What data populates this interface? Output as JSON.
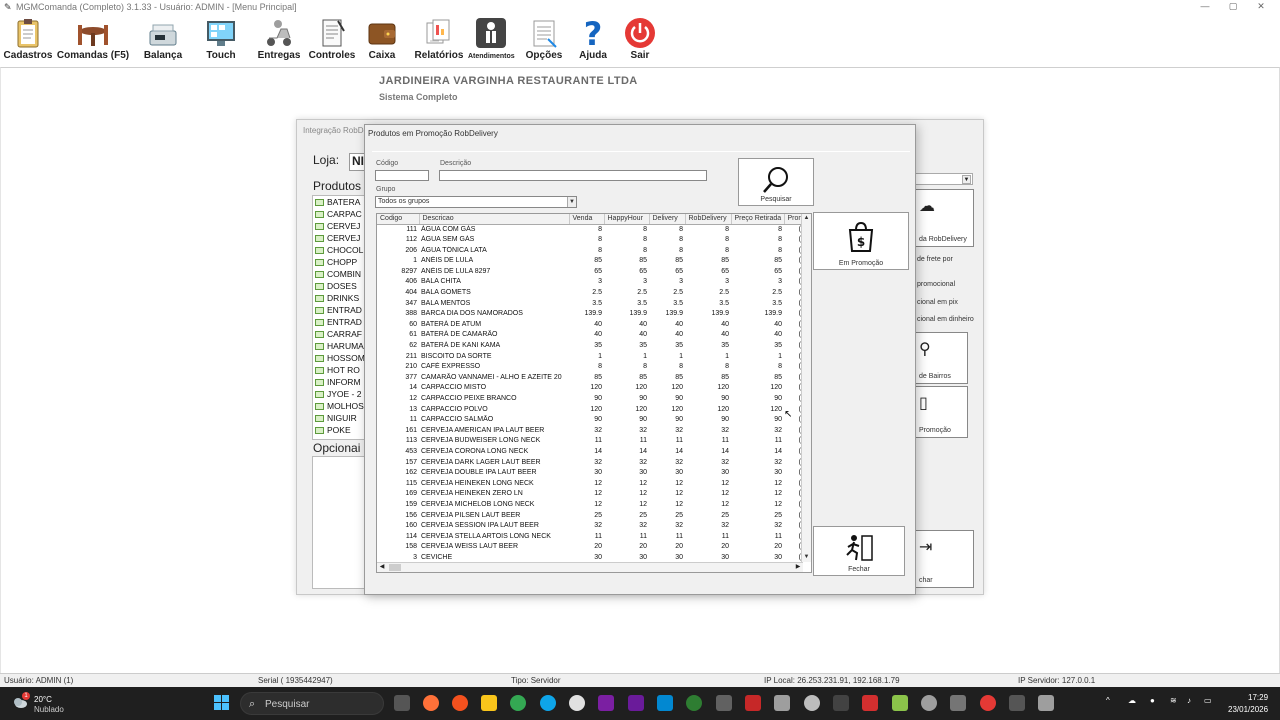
{
  "window": {
    "title": "MGMComanda (Completo) 3.1.33 - Usuário: ADMIN - [Menu Principal]"
  },
  "toolbar": [
    {
      "label": "Cadastros",
      "icon": "clipboard-icon"
    },
    {
      "label": "Comandas (F5)",
      "icon": "restaurant-table-icon"
    },
    {
      "label": "Balança",
      "icon": "scale-icon"
    },
    {
      "label": "Touch",
      "icon": "touch-screen-icon"
    },
    {
      "label": "Entregas",
      "icon": "delivery-scooter-icon"
    },
    {
      "label": "Controles",
      "icon": "notepad-icon"
    },
    {
      "label": "Caixa",
      "icon": "wallet-icon"
    },
    {
      "label": "Relatórios",
      "icon": "reports-icon"
    },
    {
      "label": "Atendimentos",
      "icon": "waiter-icon"
    },
    {
      "label": "Opções",
      "icon": "options-document-icon"
    },
    {
      "label": "Ajuda",
      "icon": "help-icon"
    },
    {
      "label": "Sair",
      "icon": "power-icon"
    }
  ],
  "company": {
    "name": "JARDINEIRA VARGINHA RESTAURANTE LTDA",
    "subtitle": "Sistema Completo"
  },
  "bg_window": {
    "title": "Integração RobDe",
    "loja_label": "Loja:",
    "loja_value": "NI",
    "produtos_label": "Produtos",
    "tree_items": [
      "BATERA",
      "CARPAC",
      "CERVEJ",
      "CERVEJ",
      "CHOCOL",
      "CHOPP",
      "COMBIN",
      "DOSES",
      "DRINKS",
      "ENTRAD",
      "ENTRAD",
      "CARRAF",
      "HARUMA",
      "HOSSOM",
      "HOT RO",
      "INFORM",
      "JYOE - 2",
      "MOLHOS",
      "NIGUIR",
      "POKE"
    ],
    "opcionais_label": "Opcionai",
    "right_texts": [
      "da RobDelivery",
      "de frete por",
      "promocional",
      "cional em pix",
      "cional em dinheiro",
      "de Bairros",
      "Promoção",
      "char"
    ]
  },
  "dialog": {
    "title": "Produtos em Promoção RobDelivery",
    "codigo_label": "Código",
    "descricao_label": "Descrição",
    "grupo_label": "Grupo",
    "grupo_value": "Todos os grupos",
    "codigo_value": "",
    "descricao_value": "",
    "pesquisar_label": "Pesquisar",
    "em_promocao_label": "Em Promoção",
    "fechar_label": "Fechar",
    "columns": [
      "Codigo",
      "Descricao",
      "Venda",
      "HappyHour",
      "Delivery",
      "RobDelivery",
      "Preço Retirada",
      "Pron"
    ],
    "rows": [
      [
        "111",
        "ÁGUA COM GÁS",
        "8",
        "8",
        "8",
        "8",
        "8",
        "("
      ],
      [
        "112",
        "ÁGUA SEM GÁS",
        "8",
        "8",
        "8",
        "8",
        "8",
        "("
      ],
      [
        "206",
        "ÁGUA TÔNICA LATA",
        "8",
        "8",
        "8",
        "8",
        "8",
        "("
      ],
      [
        "1",
        "ANÉIS DE LULA",
        "85",
        "85",
        "85",
        "85",
        "85",
        "("
      ],
      [
        "8297",
        "ANÉIS DE LULA 8297",
        "65",
        "65",
        "65",
        "65",
        "65",
        "("
      ],
      [
        "406",
        "BALA CHITA",
        "3",
        "3",
        "3",
        "3",
        "3",
        "("
      ],
      [
        "404",
        "BALA GOMETS",
        "2.5",
        "2.5",
        "2.5",
        "2.5",
        "2.5",
        "("
      ],
      [
        "347",
        "BALA MENTOS",
        "3.5",
        "3.5",
        "3.5",
        "3.5",
        "3.5",
        "("
      ],
      [
        "388",
        "BARCA DIA DOS NAMORADOS",
        "139.9",
        "139.9",
        "139.9",
        "139.9",
        "139.9",
        "("
      ],
      [
        "60",
        "BATERÁ DE ATUM",
        "40",
        "40",
        "40",
        "40",
        "40",
        "("
      ],
      [
        "61",
        "BATERÁ DE CAMARÃO",
        "40",
        "40",
        "40",
        "40",
        "40",
        "("
      ],
      [
        "62",
        "BATERÁ DE KANI KAMA",
        "35",
        "35",
        "35",
        "35",
        "35",
        "("
      ],
      [
        "211",
        "BISCOITO DA SORTE",
        "1",
        "1",
        "1",
        "1",
        "1",
        "("
      ],
      [
        "210",
        "CAFÉ EXPRESSO",
        "8",
        "8",
        "8",
        "8",
        "8",
        "("
      ],
      [
        "377",
        "CAMARÃO VANNAMEI - ALHO E AZEITE 20",
        "85",
        "85",
        "85",
        "85",
        "85",
        "("
      ],
      [
        "14",
        "CARPACCIO MISTO",
        "120",
        "120",
        "120",
        "120",
        "120",
        "("
      ],
      [
        "12",
        "CARPACCIO PEIXE BRANCO",
        "90",
        "90",
        "90",
        "90",
        "90",
        "("
      ],
      [
        "13",
        "CARPACCIO POLVO",
        "120",
        "120",
        "120",
        "120",
        "120",
        "("
      ],
      [
        "11",
        "CARPACCIO SALMÃO",
        "90",
        "90",
        "90",
        "90",
        "90",
        "("
      ],
      [
        "161",
        "CERVEJA AMERICAN IPA LAUT BEER",
        "32",
        "32",
        "32",
        "32",
        "32",
        "("
      ],
      [
        "113",
        "CERVEJA BUDWEISER LONG NECK",
        "11",
        "11",
        "11",
        "11",
        "11",
        "("
      ],
      [
        "453",
        "CERVEJA CORONA LONG NECK",
        "14",
        "14",
        "14",
        "14",
        "14",
        "("
      ],
      [
        "157",
        "CERVEJA DARK LAGER LAUT BEER",
        "32",
        "32",
        "32",
        "32",
        "32",
        "("
      ],
      [
        "162",
        "CERVEJA DOUBLE IPA LAUT BEER",
        "30",
        "30",
        "30",
        "30",
        "30",
        "("
      ],
      [
        "115",
        "CERVEJA HEINEKEN LONG NECK",
        "12",
        "12",
        "12",
        "12",
        "12",
        "("
      ],
      [
        "169",
        "CERVEJA HEINEKEN ZERO LN",
        "12",
        "12",
        "12",
        "12",
        "12",
        "("
      ],
      [
        "159",
        "CERVEJA MICHELOB LONG NECK",
        "12",
        "12",
        "12",
        "12",
        "12",
        "("
      ],
      [
        "156",
        "CERVEJA PILSEN LAUT BEER",
        "25",
        "25",
        "25",
        "25",
        "25",
        "("
      ],
      [
        "160",
        "CERVEJA SESSION IPA LAUT BEER",
        "32",
        "32",
        "32",
        "32",
        "32",
        "("
      ],
      [
        "114",
        "CERVEJA STELLA ARTOIS LONG NECK",
        "11",
        "11",
        "11",
        "11",
        "11",
        "("
      ],
      [
        "158",
        "CERVEJA WEISS LAUT BEER",
        "20",
        "20",
        "20",
        "20",
        "20",
        "("
      ],
      [
        "3",
        "CEVICHE",
        "30",
        "30",
        "30",
        "30",
        "30",
        "("
      ]
    ]
  },
  "statusbar": {
    "usuario": "Usuário: ADMIN (1)",
    "serial": "Serial ( 1935442947)",
    "tipo": "Tipo: Servidor",
    "ip_local": "IP Local: 26.253.231.91, 192.168.1.79",
    "ip_servidor": "IP Servidor: 127.0.0.1"
  },
  "taskbar": {
    "temperature": "20°C",
    "weather": "Nublado",
    "weather_badge": "1",
    "search_placeholder": "Pesquisar",
    "time": "17:29",
    "date": "23/01/2026"
  },
  "colors": {
    "taskbar_bg": "#1f1f1f",
    "folder_green": "#5d9a3c",
    "sair_red": "#e53935",
    "ajuda_blue": "#1565c0"
  }
}
